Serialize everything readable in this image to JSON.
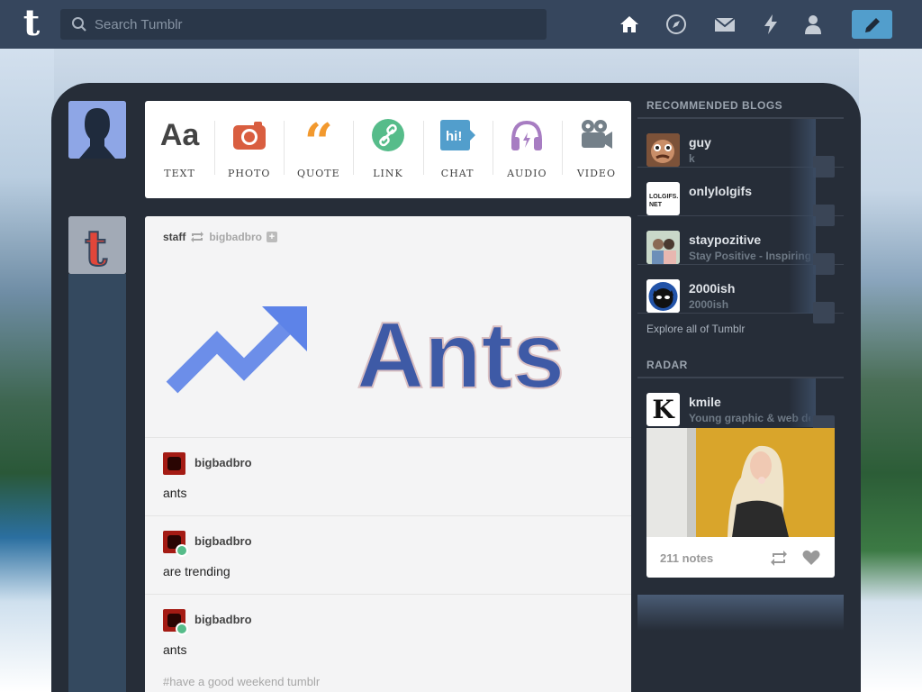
{
  "topbar": {
    "logo": "t",
    "search_placeholder": "Search Tumblr",
    "nav_icons": [
      "home-icon",
      "explore-icon",
      "inbox-icon",
      "activity-icon",
      "account-icon"
    ],
    "compose_icon": "pencil-icon"
  },
  "post_types": [
    {
      "label": "TEXT",
      "icon": "Aa",
      "color": "#444444"
    },
    {
      "label": "PHOTO",
      "icon": "camera-icon",
      "color": "#d95e40"
    },
    {
      "label": "QUOTE",
      "icon": "quote-icon",
      "color": "#f2992e"
    },
    {
      "label": "LINK",
      "icon": "link-icon",
      "color": "#56bc8a"
    },
    {
      "label": "CHAT",
      "icon": "hi!",
      "color": "#529ecc"
    },
    {
      "label": "AUDIO",
      "icon": "headphones-icon",
      "color": "#a77dc2"
    },
    {
      "label": "VIDEO",
      "icon": "video-icon",
      "color": "#748089"
    }
  ],
  "post": {
    "author": "staff",
    "reblogged_from": "bigbadbro",
    "hero_text": "Ants",
    "reblogs": [
      {
        "name": "bigbadbro",
        "text": "ants",
        "badge": false
      },
      {
        "name": "bigbadbro",
        "text": "are trending",
        "badge": true
      },
      {
        "name": "bigbadbro",
        "text": "ants",
        "badge": true
      }
    ],
    "tags": "#have a good weekend tumblr"
  },
  "sidebar": {
    "recommended_title": "RECOMMENDED BLOGS",
    "blogs": [
      {
        "name": "guy",
        "desc": "k"
      },
      {
        "name": "onlylolgifs",
        "desc": ""
      },
      {
        "name": "staypozitive",
        "desc": "Stay Positive - Inspiring"
      },
      {
        "name": "2000ish",
        "desc": "2000ish"
      }
    ],
    "onlylolgifs_avatar_text": "LOLGIFS.\nNET",
    "explore": "Explore all of Tumblr",
    "radar_title": "RADAR",
    "radar_blog": {
      "name": "kmile",
      "desc": "Young graphic & web designer",
      "avatar": "K"
    },
    "radar_notes": "211 notes"
  },
  "colors": {
    "navy": "#36465d",
    "accent": "#529ecc"
  }
}
